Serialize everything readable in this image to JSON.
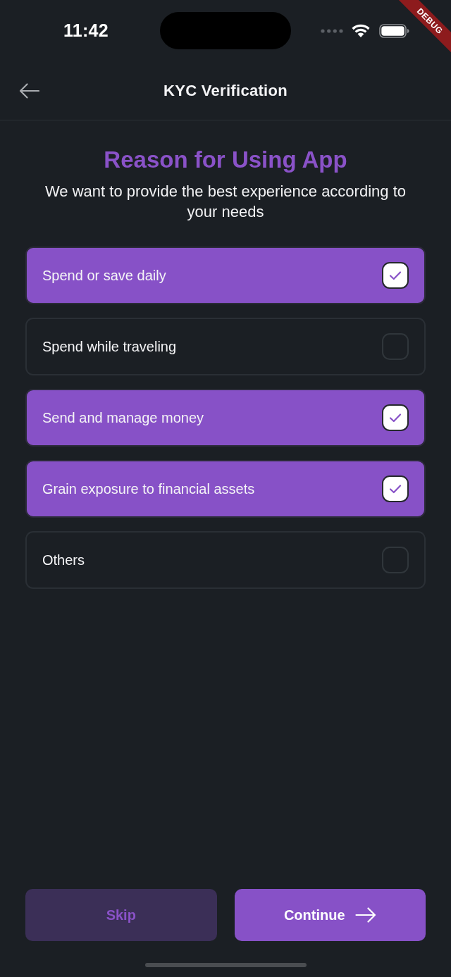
{
  "status_bar": {
    "time": "11:42"
  },
  "debug_banner": {
    "label": "DEBUG"
  },
  "header": {
    "title": "KYC Verification"
  },
  "heading": "Reason for Using App",
  "subtitle": "We want to provide the best experience according to your needs",
  "options": [
    {
      "label": "Spend or save daily",
      "checked": true
    },
    {
      "label": "Spend while traveling",
      "checked": false
    },
    {
      "label": "Send and manage money",
      "checked": true
    },
    {
      "label": "Grain exposure to financial assets",
      "checked": true
    },
    {
      "label": "Others",
      "checked": false
    }
  ],
  "buttons": [
    {
      "kind": "secondary",
      "label": "Skip"
    },
    {
      "kind": "primary",
      "label": "Continue"
    }
  ]
}
